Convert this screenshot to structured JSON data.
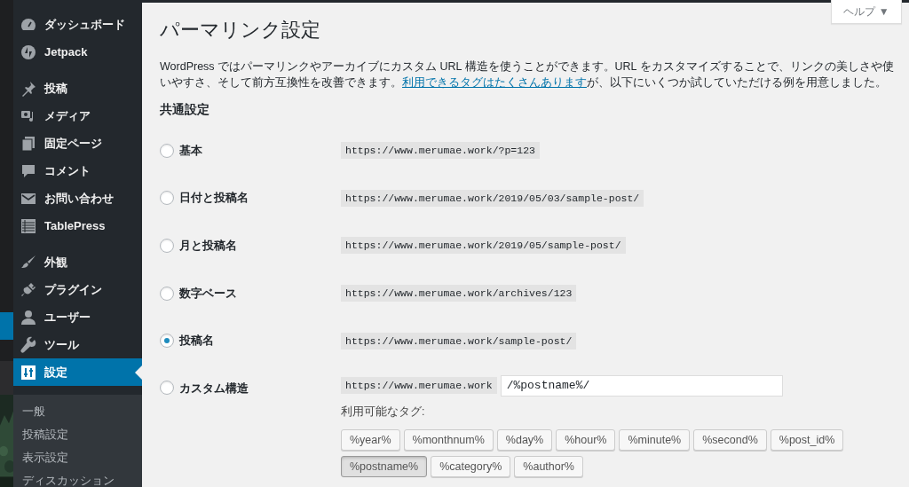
{
  "help_button": {
    "label": "ヘルプ ▼"
  },
  "sidebar": {
    "groups": [
      [
        {
          "label": "ダッシュボード",
          "selected": false
        },
        {
          "label": "Jetpack",
          "selected": false
        }
      ],
      [
        {
          "label": "投稿",
          "selected": false
        },
        {
          "label": "メディア",
          "selected": false
        },
        {
          "label": "固定ページ",
          "selected": false
        },
        {
          "label": "コメント",
          "selected": false
        },
        {
          "label": "お問い合わせ",
          "selected": false
        },
        {
          "label": "TablePress",
          "selected": false
        }
      ],
      [
        {
          "label": "外観",
          "selected": false
        },
        {
          "label": "プラグイン",
          "selected": false
        },
        {
          "label": "ユーザー",
          "selected": false
        },
        {
          "label": "ツール",
          "selected": false
        },
        {
          "label": "設定",
          "selected": true
        }
      ]
    ],
    "submenu": [
      "一般",
      "投稿設定",
      "表示設定",
      "ディスカッション"
    ]
  },
  "page": {
    "title": "パーマリンク設定",
    "description": {
      "before": "WordPress ではパーマリンクやアーカイブにカスタム URL 構造を使うことができます。URL をカスタマイズすることで、リンクの美しさや使いやすさ、そして前方互換性を改善できます。",
      "link": "利用できるタグはたくさんあります",
      "after": "が、以下にいくつか試していただける例を用意しました。"
    },
    "section_title": "共通設定",
    "options": [
      {
        "label": "基本",
        "example": "https://www.merumae.work/?p=123",
        "selected": false
      },
      {
        "label": "日付と投稿名",
        "example": "https://www.merumae.work/2019/05/03/sample-post/",
        "selected": false
      },
      {
        "label": "月と投稿名",
        "example": "https://www.merumae.work/2019/05/sample-post/",
        "selected": false
      },
      {
        "label": "数字ベース",
        "example": "https://www.merumae.work/archives/123",
        "selected": false
      },
      {
        "label": "投稿名",
        "example": "https://www.merumae.work/sample-post/",
        "selected": true
      }
    ],
    "custom": {
      "label": "カスタム構造",
      "selected": false,
      "base": "https://www.merumae.work",
      "value": "/%postname%/",
      "tags_label": "利用可能なタグ:",
      "tags": [
        {
          "label": "%year%",
          "selected": false
        },
        {
          "label": "%monthnum%",
          "selected": false
        },
        {
          "label": "%day%",
          "selected": false
        },
        {
          "label": "%hour%",
          "selected": false
        },
        {
          "label": "%minute%",
          "selected": false
        },
        {
          "label": "%second%",
          "selected": false
        },
        {
          "label": "%post_id%",
          "selected": false
        },
        {
          "label": "%postname%",
          "selected": true
        },
        {
          "label": "%category%",
          "selected": false
        },
        {
          "label": "%author%",
          "selected": false
        }
      ]
    }
  }
}
